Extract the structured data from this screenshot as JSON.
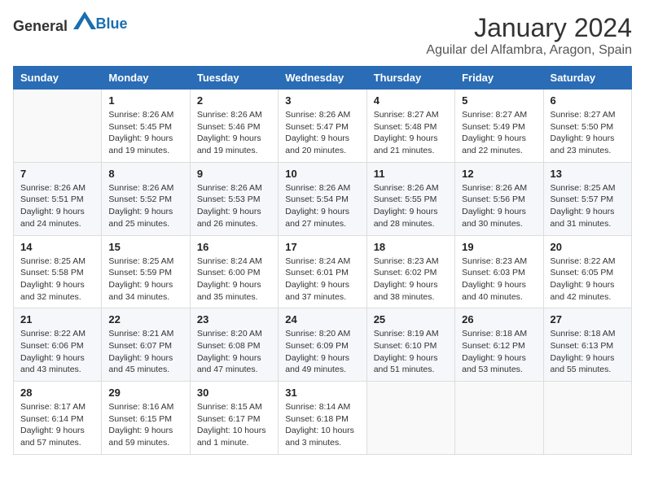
{
  "header": {
    "logo_general": "General",
    "logo_blue": "Blue",
    "title": "January 2024",
    "subtitle": "Aguilar del Alfambra, Aragon, Spain"
  },
  "days_of_week": [
    "Sunday",
    "Monday",
    "Tuesday",
    "Wednesday",
    "Thursday",
    "Friday",
    "Saturday"
  ],
  "weeks": [
    [
      {
        "day": "",
        "info": ""
      },
      {
        "day": "1",
        "info": "Sunrise: 8:26 AM\nSunset: 5:45 PM\nDaylight: 9 hours\nand 19 minutes."
      },
      {
        "day": "2",
        "info": "Sunrise: 8:26 AM\nSunset: 5:46 PM\nDaylight: 9 hours\nand 19 minutes."
      },
      {
        "day": "3",
        "info": "Sunrise: 8:26 AM\nSunset: 5:47 PM\nDaylight: 9 hours\nand 20 minutes."
      },
      {
        "day": "4",
        "info": "Sunrise: 8:27 AM\nSunset: 5:48 PM\nDaylight: 9 hours\nand 21 minutes."
      },
      {
        "day": "5",
        "info": "Sunrise: 8:27 AM\nSunset: 5:49 PM\nDaylight: 9 hours\nand 22 minutes."
      },
      {
        "day": "6",
        "info": "Sunrise: 8:27 AM\nSunset: 5:50 PM\nDaylight: 9 hours\nand 23 minutes."
      }
    ],
    [
      {
        "day": "7",
        "info": "Sunrise: 8:26 AM\nSunset: 5:51 PM\nDaylight: 9 hours\nand 24 minutes."
      },
      {
        "day": "8",
        "info": "Sunrise: 8:26 AM\nSunset: 5:52 PM\nDaylight: 9 hours\nand 25 minutes."
      },
      {
        "day": "9",
        "info": "Sunrise: 8:26 AM\nSunset: 5:53 PM\nDaylight: 9 hours\nand 26 minutes."
      },
      {
        "day": "10",
        "info": "Sunrise: 8:26 AM\nSunset: 5:54 PM\nDaylight: 9 hours\nand 27 minutes."
      },
      {
        "day": "11",
        "info": "Sunrise: 8:26 AM\nSunset: 5:55 PM\nDaylight: 9 hours\nand 28 minutes."
      },
      {
        "day": "12",
        "info": "Sunrise: 8:26 AM\nSunset: 5:56 PM\nDaylight: 9 hours\nand 30 minutes."
      },
      {
        "day": "13",
        "info": "Sunrise: 8:25 AM\nSunset: 5:57 PM\nDaylight: 9 hours\nand 31 minutes."
      }
    ],
    [
      {
        "day": "14",
        "info": "Sunrise: 8:25 AM\nSunset: 5:58 PM\nDaylight: 9 hours\nand 32 minutes."
      },
      {
        "day": "15",
        "info": "Sunrise: 8:25 AM\nSunset: 5:59 PM\nDaylight: 9 hours\nand 34 minutes."
      },
      {
        "day": "16",
        "info": "Sunrise: 8:24 AM\nSunset: 6:00 PM\nDaylight: 9 hours\nand 35 minutes."
      },
      {
        "day": "17",
        "info": "Sunrise: 8:24 AM\nSunset: 6:01 PM\nDaylight: 9 hours\nand 37 minutes."
      },
      {
        "day": "18",
        "info": "Sunrise: 8:23 AM\nSunset: 6:02 PM\nDaylight: 9 hours\nand 38 minutes."
      },
      {
        "day": "19",
        "info": "Sunrise: 8:23 AM\nSunset: 6:03 PM\nDaylight: 9 hours\nand 40 minutes."
      },
      {
        "day": "20",
        "info": "Sunrise: 8:22 AM\nSunset: 6:05 PM\nDaylight: 9 hours\nand 42 minutes."
      }
    ],
    [
      {
        "day": "21",
        "info": "Sunrise: 8:22 AM\nSunset: 6:06 PM\nDaylight: 9 hours\nand 43 minutes."
      },
      {
        "day": "22",
        "info": "Sunrise: 8:21 AM\nSunset: 6:07 PM\nDaylight: 9 hours\nand 45 minutes."
      },
      {
        "day": "23",
        "info": "Sunrise: 8:20 AM\nSunset: 6:08 PM\nDaylight: 9 hours\nand 47 minutes."
      },
      {
        "day": "24",
        "info": "Sunrise: 8:20 AM\nSunset: 6:09 PM\nDaylight: 9 hours\nand 49 minutes."
      },
      {
        "day": "25",
        "info": "Sunrise: 8:19 AM\nSunset: 6:10 PM\nDaylight: 9 hours\nand 51 minutes."
      },
      {
        "day": "26",
        "info": "Sunrise: 8:18 AM\nSunset: 6:12 PM\nDaylight: 9 hours\nand 53 minutes."
      },
      {
        "day": "27",
        "info": "Sunrise: 8:18 AM\nSunset: 6:13 PM\nDaylight: 9 hours\nand 55 minutes."
      }
    ],
    [
      {
        "day": "28",
        "info": "Sunrise: 8:17 AM\nSunset: 6:14 PM\nDaylight: 9 hours\nand 57 minutes."
      },
      {
        "day": "29",
        "info": "Sunrise: 8:16 AM\nSunset: 6:15 PM\nDaylight: 9 hours\nand 59 minutes."
      },
      {
        "day": "30",
        "info": "Sunrise: 8:15 AM\nSunset: 6:17 PM\nDaylight: 10 hours\nand 1 minute."
      },
      {
        "day": "31",
        "info": "Sunrise: 8:14 AM\nSunset: 6:18 PM\nDaylight: 10 hours\nand 3 minutes."
      },
      {
        "day": "",
        "info": ""
      },
      {
        "day": "",
        "info": ""
      },
      {
        "day": "",
        "info": ""
      }
    ]
  ]
}
